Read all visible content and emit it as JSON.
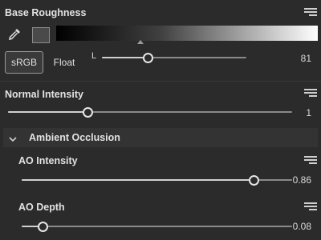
{
  "base_roughness": {
    "label": "Base Roughness",
    "color_hex": "#4a4a4a",
    "modes": [
      "sRGB",
      "Float"
    ],
    "active_mode": "sRGB",
    "channel_label": "L",
    "value": "81",
    "fraction": 0.32
  },
  "normal_intensity": {
    "label": "Normal Intensity",
    "value": "1",
    "fraction": 0.28
  },
  "ambient_occlusion": {
    "header": "Ambient Occlusion",
    "ao_intensity": {
      "label": "AO Intensity",
      "value": "0.86",
      "fraction": 0.86
    },
    "ao_depth": {
      "label": "AO Depth",
      "value": "0.08",
      "fraction": 0.08
    }
  }
}
